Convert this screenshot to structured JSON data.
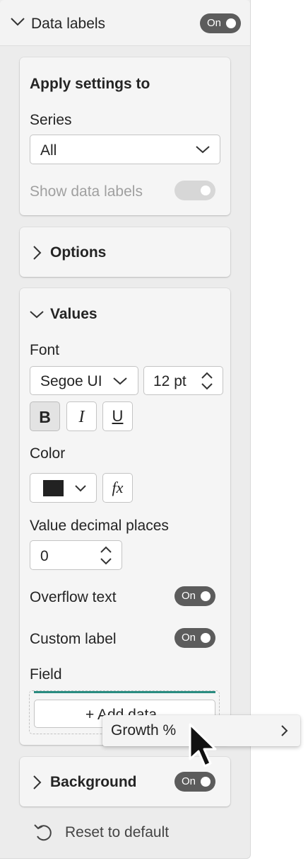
{
  "header": {
    "title": "Data labels",
    "toggle_label": "On"
  },
  "apply_settings": {
    "title": "Apply settings to",
    "series_label": "Series",
    "series_value": "All",
    "show_data_labels_label": "Show data labels"
  },
  "options": {
    "title": "Options"
  },
  "values": {
    "title": "Values",
    "font_label": "Font",
    "font_family": "Segoe UI",
    "font_size": "12 pt",
    "bold_glyph": "B",
    "italic_glyph": "I",
    "underline_glyph": "U",
    "color_label": "Color",
    "color_swatch": "#222222",
    "fx_glyph": "fx",
    "decimal_label": "Value decimal places",
    "decimal_value": "0",
    "overflow_label": "Overflow text",
    "overflow_toggle": "On",
    "custom_label": "Custom label",
    "custom_toggle": "On",
    "field_label": "Field",
    "add_data_label": "+ Add data"
  },
  "context_menu": {
    "item_label": "Growth %"
  },
  "background": {
    "title": "Background",
    "toggle_label": "On"
  },
  "footer": {
    "reset_label": "Reset to default"
  },
  "colors": {
    "accent_teal": "#2a8c80",
    "toggle_on": "#5c5c5c",
    "toggle_disabled": "#d7d7d7"
  }
}
